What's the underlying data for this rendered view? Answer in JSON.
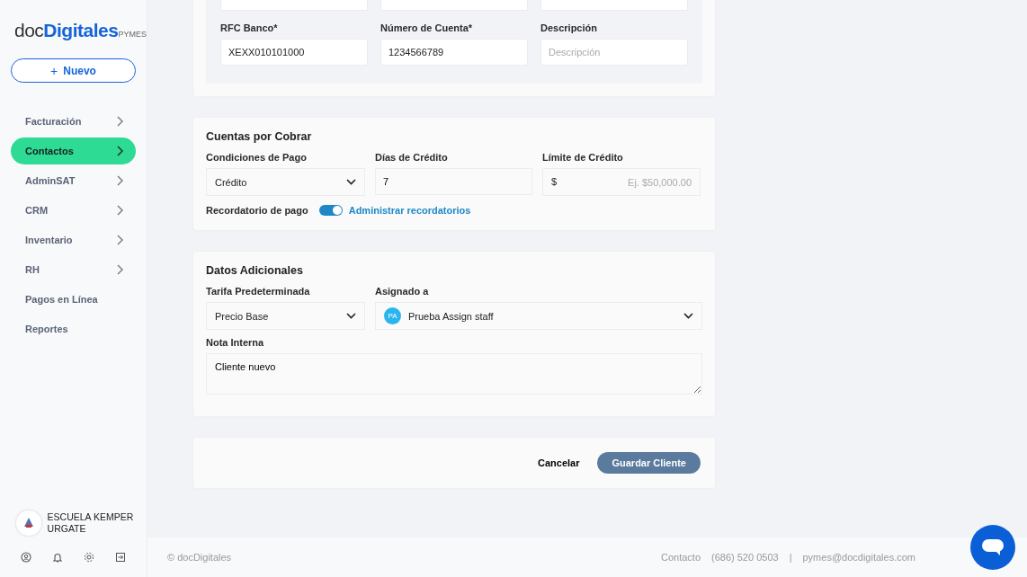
{
  "sidebar": {
    "logo": {
      "prefix": "doc",
      "brand": "Digitales",
      "suffix": "PYMES"
    },
    "new_button": {
      "icon": "+",
      "label": "Nuevo"
    },
    "items": [
      {
        "label": "Facturación",
        "selected": false,
        "has_submenu": true
      },
      {
        "label": "Contactos",
        "selected": true,
        "has_submenu": true
      },
      {
        "label": "AdminSAT",
        "selected": false,
        "has_submenu": true
      },
      {
        "label": "CRM",
        "selected": false,
        "has_submenu": true
      },
      {
        "label": "Inventario",
        "selected": false,
        "has_submenu": true
      },
      {
        "label": "RH",
        "selected": false,
        "has_submenu": true
      },
      {
        "label": "Pagos en Línea",
        "selected": false,
        "has_submenu": false
      },
      {
        "label": "Reportes",
        "selected": false,
        "has_submenu": false
      }
    ],
    "account": {
      "name": "ESCUELA KEMPER URGATE"
    }
  },
  "bank_section": {
    "fields": [
      {
        "label": "RFC Banco*",
        "value": "XEXX010101000"
      },
      {
        "label": "Número de Cuenta*",
        "value": "1234566789"
      },
      {
        "label": "Descripción",
        "placeholder": "Descripción"
      }
    ]
  },
  "receivables_section": {
    "title": "Cuentas por Cobrar",
    "payment_terms": {
      "label": "Condiciones de Pago",
      "value": "Crédito"
    },
    "credit_days": {
      "label": "Días de Crédito",
      "value": "7"
    },
    "credit_limit": {
      "label": "Límite de Crédito",
      "prefix": "$",
      "placeholder": "Ej. $50,000.00"
    },
    "reminder": {
      "label": "Recordatorio de pago",
      "on": true,
      "link": "Administrar recordatorios"
    }
  },
  "additional_section": {
    "title": "Datos Adicionales",
    "rate": {
      "label": "Tarifa Predeterminada",
      "value": "Precio Base"
    },
    "assigned": {
      "label": "Asignado a",
      "initials": "PA",
      "value": "Prueba Assign staff"
    },
    "note": {
      "label": "Nota Interna",
      "value": "Cliente nuevo"
    }
  },
  "actions": {
    "cancel": "Cancelar",
    "save": "Guardar Cliente"
  },
  "footer": {
    "copyright": "© docDigitales",
    "contact_label": "Contacto",
    "phone": "(686) 520 0503",
    "separator": "|",
    "email": "pymes@docdigitales.com"
  }
}
